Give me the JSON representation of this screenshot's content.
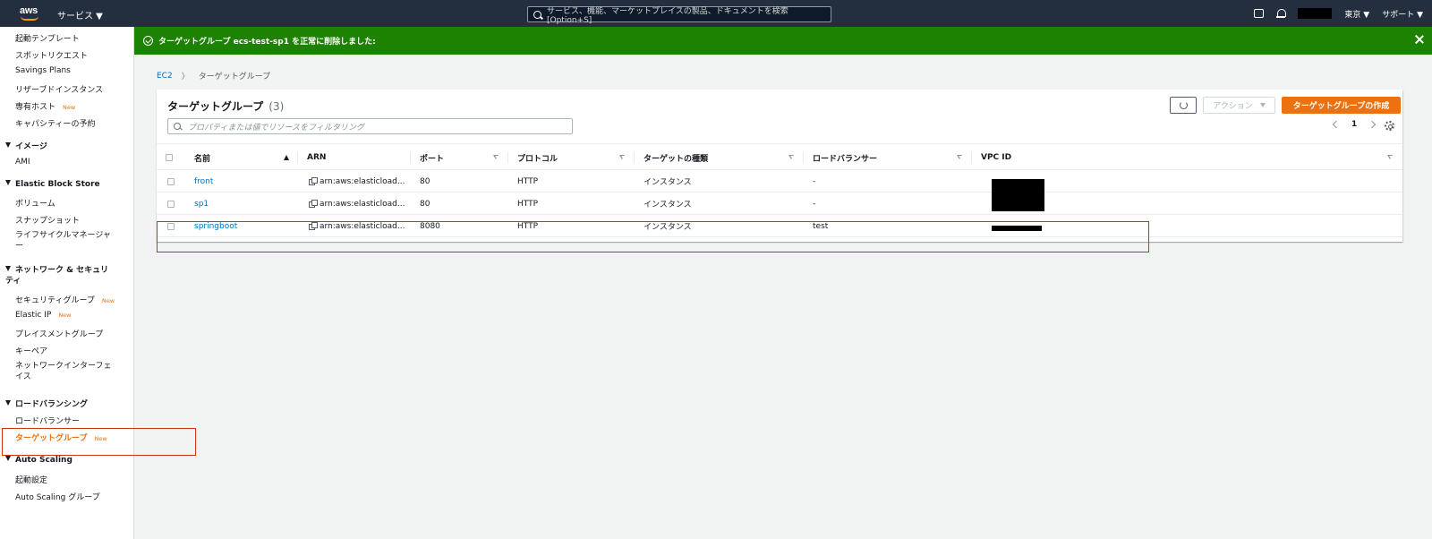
{
  "topnav": {
    "logo_text": "aws",
    "services_label": "サービス ▼",
    "search_placeholder": "サービス、機能、マーケットプレイスの製品、ドキュメントを検索 [Option+S]",
    "region_label": "東京 ▼",
    "support_label": "サポート ▼"
  },
  "sidebar": {
    "items": [
      {
        "label": "起動テンプレート"
      },
      {
        "label": "スポットリクエスト"
      },
      {
        "label": "Savings Plans"
      },
      {
        "label": "リザーブドインスタンス"
      },
      {
        "label": "専有ホスト",
        "badge": "New"
      },
      {
        "label": "キャパシティーの予約"
      }
    ],
    "sections": {
      "images": {
        "title": "イメージ",
        "items": [
          "AMI"
        ]
      },
      "ebs": {
        "title": "Elastic Block Store",
        "items": [
          "ボリューム",
          "スナップショット",
          "ライフサイクルマネージャー"
        ]
      },
      "network": {
        "title": "ネットワーク & セキュリティ",
        "items": [
          "セキュリティグループ",
          "Elastic IP",
          "プレイスメントグループ",
          "キーペア",
          "ネットワークインターフェイス"
        ],
        "badge": "New"
      },
      "lb": {
        "title": "ロードバランシング",
        "items": [
          "ロードバランサー",
          "ターゲットグループ"
        ],
        "badge": "New"
      },
      "asg": {
        "title": "Auto Scaling",
        "items": [
          "起動設定",
          "Auto Scaling グループ"
        ]
      }
    }
  },
  "flash": {
    "message": "ターゲットグループ ecs-test-sp1 を正常に削除しました:"
  },
  "breadcrumb": {
    "root": "EC2",
    "separator": "〉",
    "current": "ターゲットグループ"
  },
  "panel": {
    "title": "ターゲットグループ",
    "count": "(3)",
    "action_label": "アクション",
    "create_label": "ターゲットグループの作成",
    "filter_placeholder": "プロパティまたは値でリソースをフィルタリング",
    "page_number": "1"
  },
  "table": {
    "columns": [
      "名前",
      "ARN",
      "ポート",
      "プロトコル",
      "ターゲットの種類",
      "ロードバランサー",
      "VPC ID"
    ],
    "rows": [
      {
        "name": "front",
        "arn": "arn:aws:elasticload...",
        "port": "80",
        "protocol": "HTTP",
        "target_type": "インスタンス",
        "lb": "-"
      },
      {
        "name": "sp1",
        "arn": "arn:aws:elasticload...",
        "port": "80",
        "protocol": "HTTP",
        "target_type": "インスタンス",
        "lb": "-"
      },
      {
        "name": "springboot",
        "arn": "arn:aws:elasticload...",
        "port": "8080",
        "protocol": "HTTP",
        "target_type": "インスタンス",
        "lb": "test"
      }
    ]
  },
  "colors": {
    "nav_bg": "#232f3e",
    "flash_success": "#1d8102",
    "primary_orange": "#ec7211",
    "link_blue": "#0073bb",
    "highlight_red": "#d13212"
  }
}
